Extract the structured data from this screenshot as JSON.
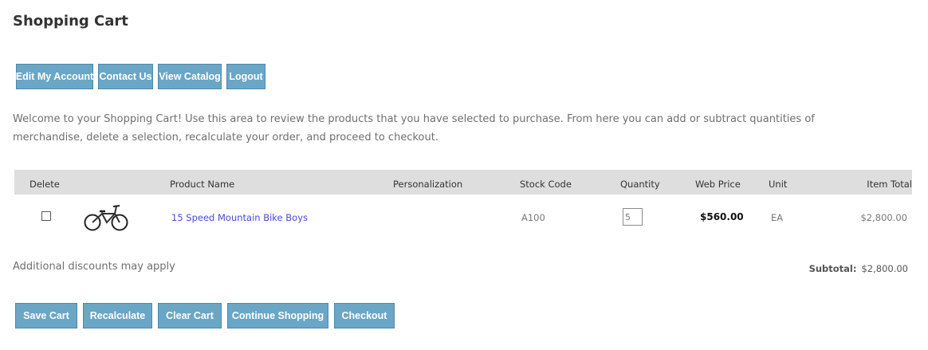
{
  "page": {
    "title": "Shopping Cart",
    "intro": "Welcome to your Shopping Cart! Use this area to review the products that you have selected to purchase. From here you can add or subtract quantities of merchandise, delete a selection, recalculate your order, and proceed to checkout."
  },
  "nav": {
    "edit_account": "Edit My Account",
    "contact": "Contact Us",
    "catalog": "View Catalog",
    "logout": "Logout"
  },
  "table": {
    "headers": {
      "delete": "Delete",
      "product": "Product Name",
      "personalization": "Personalization",
      "stock": "Stock Code",
      "quantity": "Quantity",
      "price": "Web Price",
      "unit": "Unit",
      "total": "Item Total"
    },
    "rows": [
      {
        "image_icon": "bicycle-icon",
        "product": "15 Speed Mountain Bike Boys",
        "personalization": "",
        "stock": "A100",
        "quantity": "5",
        "price": "$560.00",
        "unit": "EA",
        "total": "$2,800.00"
      }
    ]
  },
  "footer": {
    "discounts": "Additional discounts may apply",
    "subtotal_label": "Subtotal:",
    "subtotal_value": "$2,800.00"
  },
  "actions": {
    "save": "Save Cart",
    "recalc": "Recalculate",
    "clear": "Clear Cart",
    "continue": "Continue Shopping",
    "checkout": "Checkout"
  },
  "colors": {
    "button": "#6aa6c6",
    "header_bar": "#dedede",
    "link": "#4a4adb"
  }
}
